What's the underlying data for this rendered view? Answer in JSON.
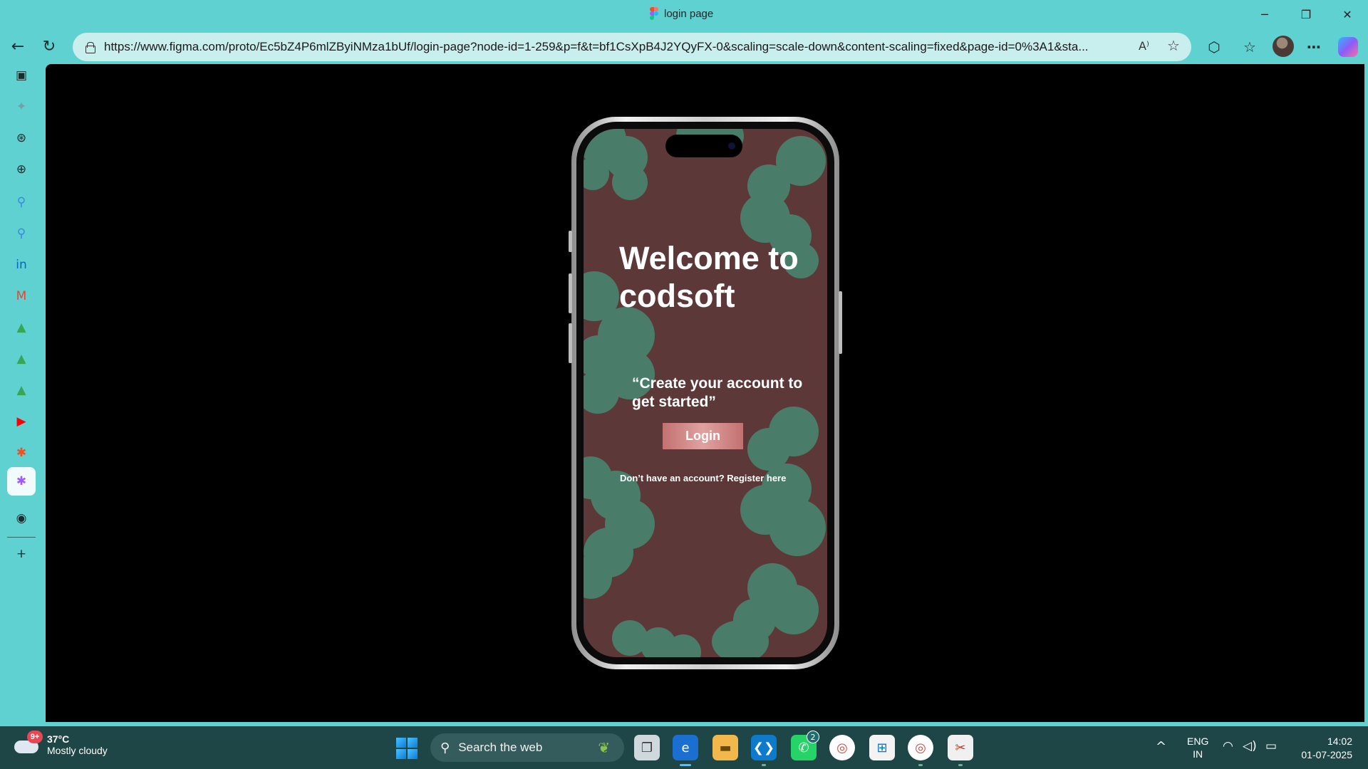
{
  "window": {
    "tab_title": "login page",
    "minimize_glyph": "─",
    "restore_glyph": "❐",
    "close_glyph": "✕"
  },
  "navbar": {
    "back_glyph": "←",
    "reload_glyph": "↻",
    "url": "https://www.figma.com/proto/Ec5bZ4P6mlZByiNMza1bUf/login-page?node-id=1-259&p=f&t=bf1CsXpB4J2YQyFX-0&scaling=scale-down&content-scaling=fixed&page-id=0%3A1&sta...",
    "read_aloud_glyph": "A⁾",
    "star_glyph": "☆",
    "extensions_glyph": "⬡",
    "favorites_glyph": "☆",
    "more_glyph": "⋯"
  },
  "sidebar": {
    "icons": [
      {
        "name": "tabs-icon",
        "glyph": "▣",
        "color": "#1c2b2b"
      },
      {
        "name": "copilot-sidebar-icon",
        "glyph": "✦",
        "color": "#6fa3a3"
      },
      {
        "name": "chatgpt-icon",
        "glyph": "⊛",
        "color": "#1c2b2b"
      },
      {
        "name": "globe-icon",
        "glyph": "⊕",
        "color": "#1c2b2b"
      },
      {
        "name": "search-icon",
        "glyph": "⚲",
        "color": "#3a8ad8"
      },
      {
        "name": "search-icon-2",
        "glyph": "⚲",
        "color": "#3a8ad8"
      },
      {
        "name": "linkedin-icon",
        "glyph": "in",
        "color": "#0a66c2"
      },
      {
        "name": "gmail-icon",
        "glyph": "M",
        "color": "#ea4335"
      },
      {
        "name": "drive-icon",
        "glyph": "▲",
        "color": "#34a853"
      },
      {
        "name": "drive-icon-2",
        "glyph": "▲",
        "color": "#34a853"
      },
      {
        "name": "drive-icon-3",
        "glyph": "▲",
        "color": "#34a853"
      },
      {
        "name": "youtube-icon",
        "glyph": "▶",
        "color": "#ff0000"
      },
      {
        "name": "figma-icon",
        "glyph": "✱",
        "color": "#f24e1e"
      },
      {
        "name": "figma-active-icon",
        "glyph": "✱",
        "color": "#a259ff"
      },
      {
        "name": "github-icon",
        "glyph": "◉",
        "color": "#1c2b2b"
      },
      {
        "name": "add-icon",
        "glyph": "+",
        "color": "#1c2b2b"
      }
    ]
  },
  "prototype": {
    "title": "Welcome to codsoft",
    "tagline": "“Create your account to get started”",
    "login_label": "Login",
    "register_text": "Don’t  have an account? Register here",
    "colors": {
      "background": "#5c3838",
      "blob": "#4a7d69"
    }
  },
  "taskbar": {
    "weather": {
      "temp": "37°C",
      "condition": "Mostly cloudy",
      "badge": "9+"
    },
    "search_placeholder": "Search the web",
    "search_glyph": "⚲",
    "plant_glyph": "❦",
    "apps": [
      {
        "name": "task-view-icon",
        "glyph": "❐"
      },
      {
        "name": "edge-icon",
        "glyph": "e"
      },
      {
        "name": "file-explorer-icon",
        "glyph": "▬"
      },
      {
        "name": "vscode-icon",
        "glyph": "❮❯"
      },
      {
        "name": "whatsapp-icon",
        "glyph": "✆",
        "badge": "2"
      },
      {
        "name": "chrome-icon",
        "glyph": "◎"
      },
      {
        "name": "ms-store-icon",
        "glyph": "⊞"
      },
      {
        "name": "chrome-icon-2",
        "glyph": "◎"
      },
      {
        "name": "snipping-tool-icon",
        "glyph": "✂"
      }
    ],
    "tray_chevron": "^",
    "language": {
      "line1": "ENG",
      "line2": "IN"
    },
    "wifi_glyph": "◠",
    "volume_glyph": "◁)",
    "battery_glyph": "▭",
    "time": "14:02",
    "date": "01-07-2025"
  }
}
